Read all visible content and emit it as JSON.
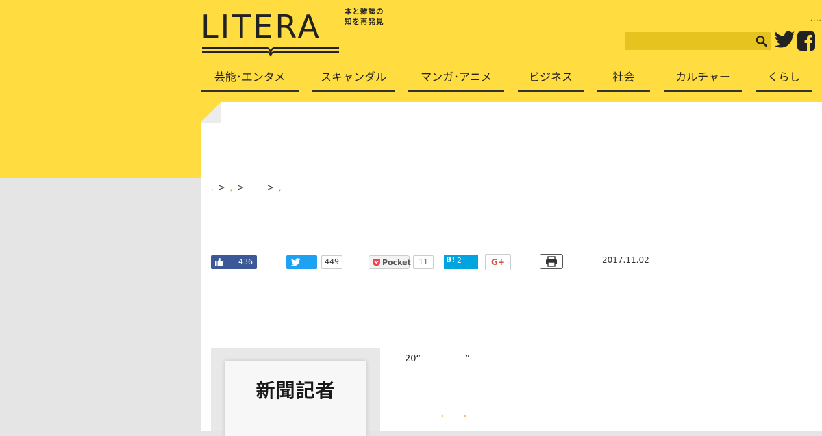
{
  "logo": {
    "wordmark": "LITERA",
    "tagline": "本と雑誌の知を再発見"
  },
  "header": {
    "dots": "....",
    "search": {
      "placeholder": "",
      "value": ""
    }
  },
  "nav": {
    "items": [
      {
        "label": "芸能･エンタメ"
      },
      {
        "label": "スキャンダル"
      },
      {
        "label": "マンガ･アニメ"
      },
      {
        "label": "ビジネス"
      },
      {
        "label": "社会"
      },
      {
        "label": "カルチャー"
      },
      {
        "label": "くらし"
      }
    ]
  },
  "breadcrumb": {
    "sep1": ">",
    "sep2": ">",
    "sep3": ">"
  },
  "share": {
    "facebook_count": "436",
    "twitter_count": "449",
    "pocket_label": "Pocket",
    "pocket_count": "11",
    "hatena_label": "B!",
    "hatena_count": "2",
    "gplus_label": "G+"
  },
  "article": {
    "date": "2017.11.02",
    "book_title": "新聞記者",
    "lead_text": "—20“　　　　　”"
  },
  "colors": {
    "brand_yellow": "#ffdd40",
    "facebook": "#3b5998",
    "twitter": "#1da1f2",
    "hatena": "#00a4de",
    "link_orange": "#d88a00"
  }
}
